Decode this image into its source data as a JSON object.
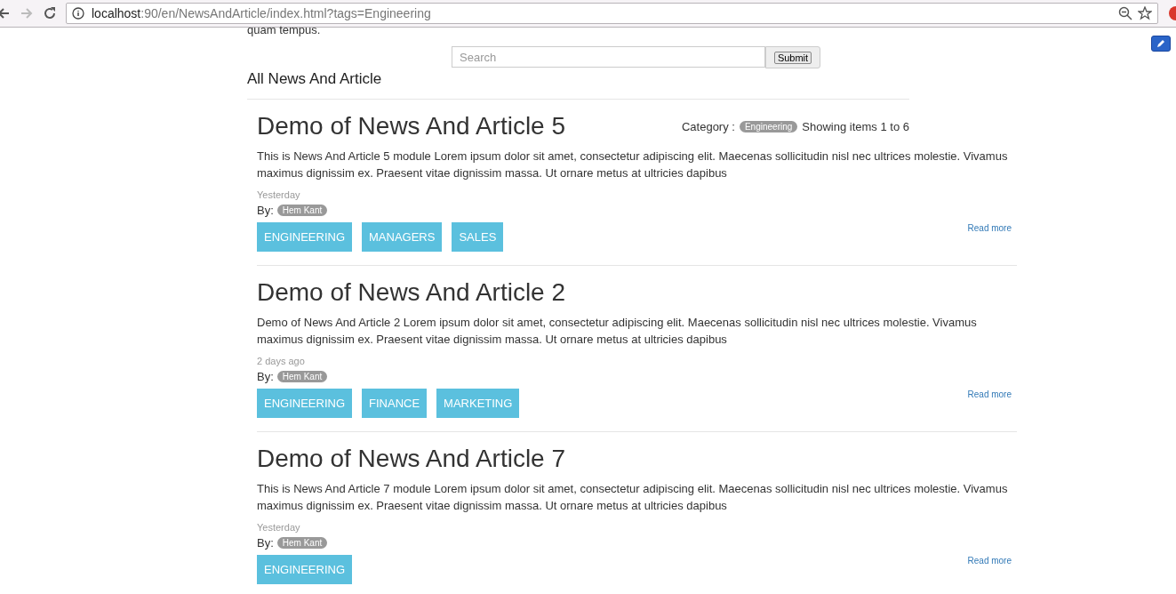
{
  "browser": {
    "url_host": "localhost",
    "url_rest": ":90/en/NewsAndArticle/index.html?tags=Engineering"
  },
  "page": {
    "cut_text": "quam tempus.",
    "search": {
      "placeholder": "Search",
      "button": "Submit"
    },
    "heading": "All News And Article",
    "filter": {
      "label": "Category :",
      "category": "Engineering",
      "showing": "Showing items 1 to 6"
    },
    "articles": [
      {
        "title": "Demo of News And Article 5",
        "body": "This is News And Article 5 module Lorem ipsum dolor sit amet, consectetur adipiscing elit. Maecenas sollicitudin nisl nec ultrices molestie. Vivamus maximus dignissim ex. Praesent vitae dignissim massa. Ut ornare metus at ultricies dapibus",
        "date": "Yesterday",
        "by": "By:",
        "author": "Hem Kant",
        "tags": [
          "ENGINEERING",
          "MANAGERS",
          "SALES"
        ],
        "read_more": "Read more"
      },
      {
        "title": "Demo of News And Article 2",
        "body": "Demo of News And Article 2 Lorem ipsum dolor sit amet, consectetur adipiscing elit. Maecenas sollicitudin nisl nec ultrices molestie. Vivamus maximus dignissim ex. Praesent vitae dignissim massa. Ut ornare metus at ultricies dapibus",
        "date": "2 days ago",
        "by": "By:",
        "author": "Hem Kant",
        "tags": [
          "ENGINEERING",
          "FINANCE",
          "MARKETING"
        ],
        "read_more": "Read more"
      },
      {
        "title": "Demo of News And Article 7",
        "body": "This is News And Article 7 module Lorem ipsum dolor sit amet, consectetur adipiscing elit. Maecenas sollicitudin nisl nec ultrices molestie. Vivamus maximus dignissim ex. Praesent vitae dignissim massa. Ut ornare metus at ultricies dapibus",
        "date": "Yesterday",
        "by": "By:",
        "author": "Hem Kant",
        "tags": [
          "ENGINEERING"
        ],
        "read_more": "Read more"
      }
    ]
  }
}
